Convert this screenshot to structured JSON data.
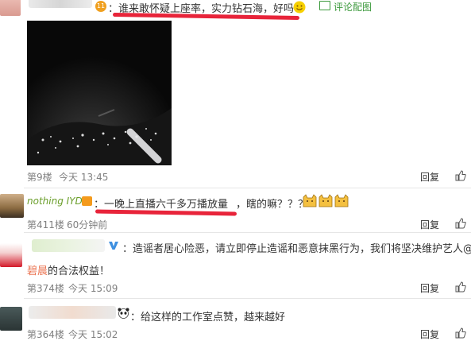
{
  "comments": [
    {
      "text": "：谁来敢怀疑上座率，实力钻石海，好吗",
      "image_action": "评论配图",
      "floor": "第9楼",
      "time": "今天 13:45",
      "reply": "回复"
    },
    {
      "username": "nothing IYD",
      "text_main": "：一晚上直播六千多万播放量",
      "text_tail": "，瞎的嘛？？？",
      "floor": "第411楼",
      "time": "60分钟前",
      "reply": "回复"
    },
    {
      "text_line1": "：造谣者居心险恶，请立即停止造谣和恶意抹黑行为，我们将坚决维护艺人@张",
      "text_line2_highlight": "碧晨",
      "text_line2": " 的合法权益！",
      "floor": "第374楼",
      "time": "今天 15:09",
      "reply": "回复"
    },
    {
      "text": "：给这样的工作室点赞，越来越好",
      "floor": "第364楼",
      "time": "今天 15:02",
      "reply": "回复"
    }
  ],
  "colors": {
    "link": "#eb7350",
    "annotation": "#e8243a",
    "username": "#6a9e2a",
    "meta": "#808080"
  }
}
